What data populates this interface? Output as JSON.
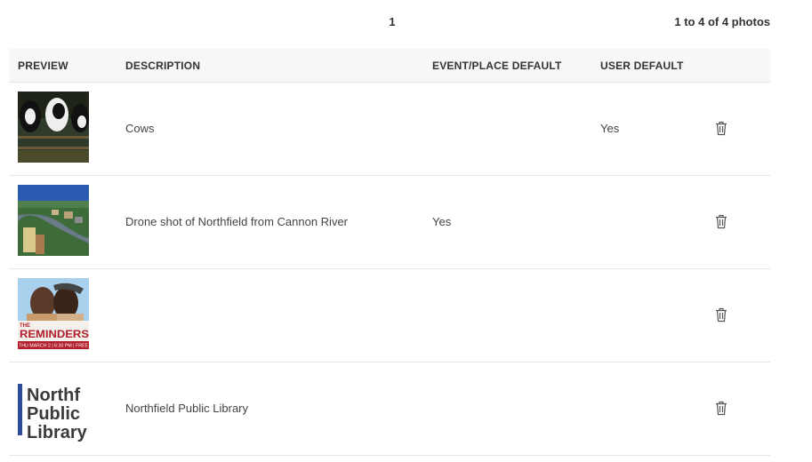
{
  "pagination": {
    "current_page": "1",
    "summary": "1 to 4 of 4 photos"
  },
  "columns": {
    "preview": "PREVIEW",
    "description": "DESCRIPTION",
    "event_default": "EVENT/PLACE DEFAULT",
    "user_default": "USER DEFAULT"
  },
  "rows": [
    {
      "description": "Cows",
      "event_default": "",
      "user_default": "Yes",
      "thumb_text": ""
    },
    {
      "description": "Drone shot of Northfield from Cannon River",
      "event_default": "Yes",
      "user_default": "",
      "thumb_text": ""
    },
    {
      "description": "",
      "event_default": "",
      "user_default": "",
      "thumb_text": "REMINDERS",
      "thumb_sub": "THU MARCH 2 | 6:30 PM | FREE",
      "thumb_top": "THE"
    },
    {
      "description": "Northfield Public Library",
      "event_default": "",
      "user_default": "",
      "thumb_text": "Northfield Public Library",
      "thumb_lines": [
        "Northf",
        "Public",
        "Library"
      ]
    }
  ],
  "icons": {
    "delete": "trash-icon"
  },
  "colors": {
    "header_bg": "#f7f7f7",
    "border": "#e6e6e6",
    "text": "#333333"
  }
}
